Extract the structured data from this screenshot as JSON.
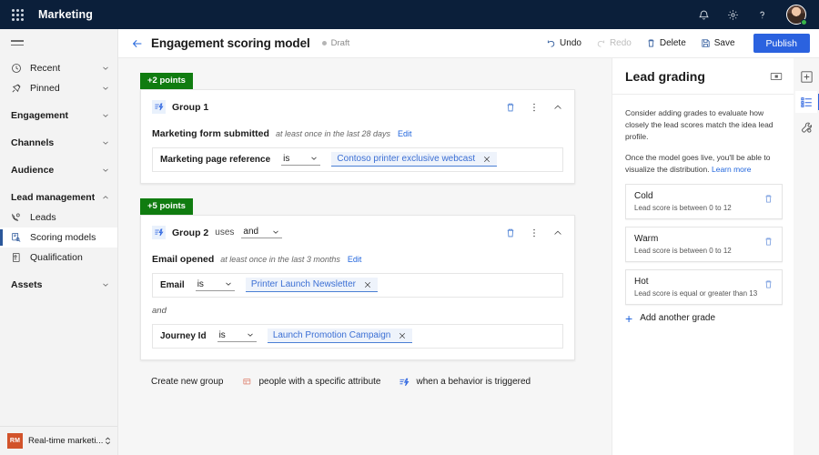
{
  "topbar": {
    "waffle_name": "app-launcher",
    "brand": "Marketing",
    "icons": [
      {
        "name": "notifications-icon",
        "glyph": "bell"
      },
      {
        "name": "settings-icon",
        "glyph": "gear"
      },
      {
        "name": "help-icon",
        "glyph": "question"
      }
    ],
    "avatar_name": "user-avatar",
    "bg_color": "#0b1f3a"
  },
  "sidebar": {
    "hamburger_label": "Show or hide navigation",
    "items": [
      {
        "label": "Recent",
        "icon": "clock-icon",
        "type": "item",
        "expandable": true,
        "active": false
      },
      {
        "label": "Pinned",
        "icon": "pin-icon",
        "type": "item",
        "expandable": true,
        "active": false
      },
      {
        "label": "Engagement",
        "icon": "",
        "type": "header",
        "expandable": true,
        "active": false
      },
      {
        "label": "Channels",
        "icon": "",
        "type": "header",
        "expandable": true,
        "active": false
      },
      {
        "label": "Audience",
        "icon": "",
        "type": "header",
        "expandable": true,
        "active": false
      },
      {
        "label": "Lead management",
        "icon": "",
        "type": "header",
        "expandable": true,
        "expanded": true,
        "active": false
      },
      {
        "label": "Leads",
        "icon": "leads-icon",
        "type": "sub",
        "expandable": false,
        "active": false
      },
      {
        "label": "Scoring models",
        "icon": "scoring-models-icon",
        "type": "sub",
        "expandable": false,
        "active": true
      },
      {
        "label": "Qualification",
        "icon": "qualification-icon",
        "type": "sub",
        "expandable": false,
        "active": false
      },
      {
        "label": "Assets",
        "icon": "",
        "type": "header",
        "expandable": true,
        "active": false
      }
    ],
    "footer": {
      "initials": "RM",
      "name": "Real-time marketi...",
      "badge_color": "#d2532b"
    }
  },
  "command_bar": {
    "back_name": "back-arrow",
    "title": "Engagement scoring model",
    "status": "Draft",
    "actions": [
      {
        "label": "Undo",
        "icon": "undo-icon",
        "disabled": false
      },
      {
        "label": "Redo",
        "icon": "redo-icon",
        "disabled": true
      },
      {
        "label": "Delete",
        "icon": "delete-icon",
        "disabled": false
      },
      {
        "label": "Save",
        "icon": "save-icon",
        "disabled": false
      }
    ],
    "publish_label": "Publish",
    "publish_color": "#2b62df"
  },
  "canvas": {
    "groups": [
      {
        "points": "+2 points",
        "points_color": "#107c10",
        "name": "Group 1",
        "uses_label": "",
        "operator": "",
        "trigger": {
          "name": "Marketing form submitted",
          "qualifier": "at least once in the last 28 days",
          "edit_label": "Edit"
        },
        "conditions": [
          {
            "field": "Marketing page reference",
            "operator": "is",
            "value": "Contoso printer exclusive webcast"
          }
        ],
        "separator": ""
      },
      {
        "points": "+5 points",
        "points_color": "#107c10",
        "name": "Group 2",
        "uses_label": "uses",
        "operator": "and",
        "trigger": {
          "name": "Email opened",
          "qualifier": "at least once in the last 3 months",
          "edit_label": "Edit"
        },
        "conditions": [
          {
            "field": "Email",
            "operator": "is",
            "value": "Printer Launch Newsletter"
          },
          {
            "field": "Journey Id",
            "operator": "is",
            "value": "Launch Promotion Campaign"
          }
        ],
        "separator": "and"
      }
    ],
    "create_row": {
      "label": "Create new group",
      "options": [
        {
          "text": "people with a specific attribute",
          "icon": "attribute-group-icon"
        },
        {
          "text": "when a behavior is triggered",
          "icon": "behavior-trigger-icon"
        }
      ]
    }
  },
  "right_panel": {
    "title": "Lead grading",
    "collapse_name": "collapse-panel-icon",
    "paragraphs": [
      "Consider adding grades to evaluate how closely the lead scores match the idea lead profile.",
      "Once the model goes live, you'll be able to visualize the distribution."
    ],
    "learn_more": "Learn more",
    "grades": [
      {
        "name": "Cold",
        "description": "Lead score is between 0 to 12"
      },
      {
        "name": "Warm",
        "description": "Lead score is between 0 to 12"
      },
      {
        "name": "Hot",
        "description": "Lead score is equal or greater than 13"
      }
    ],
    "add_grade_label": "Add another grade"
  },
  "rail": {
    "buttons": [
      {
        "name": "add-panel-icon",
        "active": false
      },
      {
        "name": "lead-grading-list-icon",
        "active": true
      },
      {
        "name": "model-settings-icon",
        "active": false
      }
    ]
  }
}
